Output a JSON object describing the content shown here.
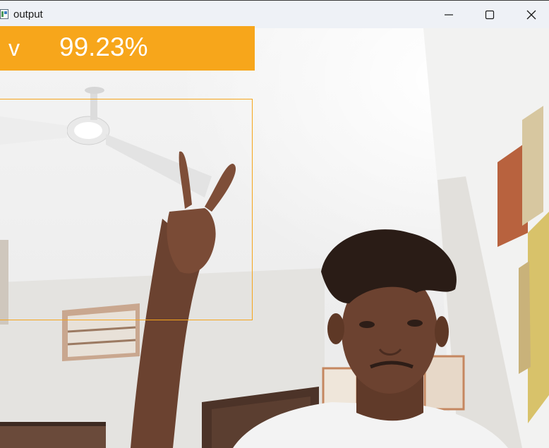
{
  "window": {
    "title": "output",
    "icon": "app-window-icon",
    "controls": {
      "minimize_icon": "minimize-icon",
      "maximize_icon": "maximize-icon",
      "close_icon": "close-icon"
    }
  },
  "detection": {
    "class_label": "v",
    "confidence": "99.23%",
    "color": "#f7a61b"
  }
}
